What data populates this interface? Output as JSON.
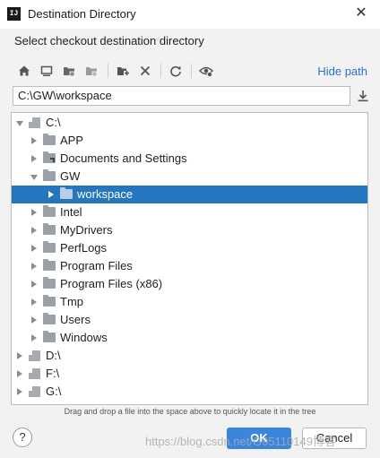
{
  "window": {
    "title": "Destination Directory",
    "subtitle": "Select checkout destination directory",
    "app_icon_text": "IJ"
  },
  "toolbar": {
    "buttons": [
      "home-icon",
      "desktop-icon",
      "project-folder-icon",
      "module-folder-icon",
      "new-folder-icon",
      "delete-icon",
      "refresh-icon",
      "show-hidden-icon"
    ],
    "hide_path_label": "Hide path"
  },
  "path_field": {
    "value": "C:\\GW\\workspace"
  },
  "tree": {
    "nodes": [
      {
        "label": "C:\\",
        "depth": 0,
        "expanded": true,
        "icon": "drive-icon"
      },
      {
        "label": "APP",
        "depth": 1,
        "expanded": false,
        "icon": "folder-icon"
      },
      {
        "label": "Documents and Settings",
        "depth": 1,
        "expanded": false,
        "icon": "folder-link-icon"
      },
      {
        "label": "GW",
        "depth": 1,
        "expanded": true,
        "icon": "folder-icon"
      },
      {
        "label": "workspace",
        "depth": 2,
        "expanded": false,
        "icon": "folder-icon",
        "selected": true
      },
      {
        "label": "Intel",
        "depth": 1,
        "expanded": false,
        "icon": "folder-icon"
      },
      {
        "label": "MyDrivers",
        "depth": 1,
        "expanded": false,
        "icon": "folder-icon"
      },
      {
        "label": "PerfLogs",
        "depth": 1,
        "expanded": false,
        "icon": "folder-icon"
      },
      {
        "label": "Program Files",
        "depth": 1,
        "expanded": false,
        "icon": "folder-icon"
      },
      {
        "label": "Program Files (x86)",
        "depth": 1,
        "expanded": false,
        "icon": "folder-icon"
      },
      {
        "label": "Tmp",
        "depth": 1,
        "expanded": false,
        "icon": "folder-icon"
      },
      {
        "label": "Users",
        "depth": 1,
        "expanded": false,
        "icon": "folder-icon"
      },
      {
        "label": "Windows",
        "depth": 1,
        "expanded": false,
        "icon": "folder-icon"
      },
      {
        "label": "D:\\",
        "depth": 0,
        "expanded": false,
        "icon": "drive-icon"
      },
      {
        "label": "F:\\",
        "depth": 0,
        "expanded": false,
        "icon": "drive-icon"
      },
      {
        "label": "G:\\",
        "depth": 0,
        "expanded": false,
        "icon": "drive-icon"
      }
    ]
  },
  "hint": "Drag and drop a file into the space above to quickly locate it in the tree",
  "buttons": {
    "help": "?",
    "ok": "OK",
    "cancel": "Cancel"
  },
  "watermark": "https://blog.csdn.net/G95110149博客",
  "colors": {
    "selection": "#2675bf",
    "ok_button": "#3a86dc",
    "link": "#2b6ecb"
  }
}
